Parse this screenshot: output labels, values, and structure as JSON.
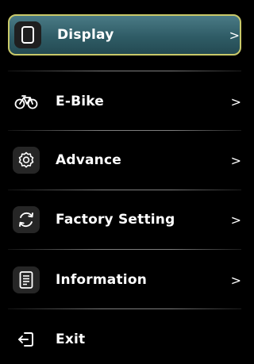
{
  "menu": {
    "items": [
      {
        "label": "Display",
        "icon": "display-icon",
        "chevron": ">",
        "selected": true
      },
      {
        "label": "E-Bike",
        "icon": "bicycle-icon",
        "chevron": ">"
      },
      {
        "label": "Advance",
        "icon": "gear-icon",
        "chevron": ">"
      },
      {
        "label": "Factory Setting",
        "icon": "reset-icon",
        "chevron": ">"
      },
      {
        "label": "Information",
        "icon": "document-icon",
        "chevron": ">"
      },
      {
        "label": "Exit",
        "icon": "exit-icon"
      }
    ]
  },
  "colors": {
    "background": "#000000",
    "selected_fill": "#2f5c66",
    "selected_border": "#c9c96a",
    "text": "#ffffff"
  }
}
